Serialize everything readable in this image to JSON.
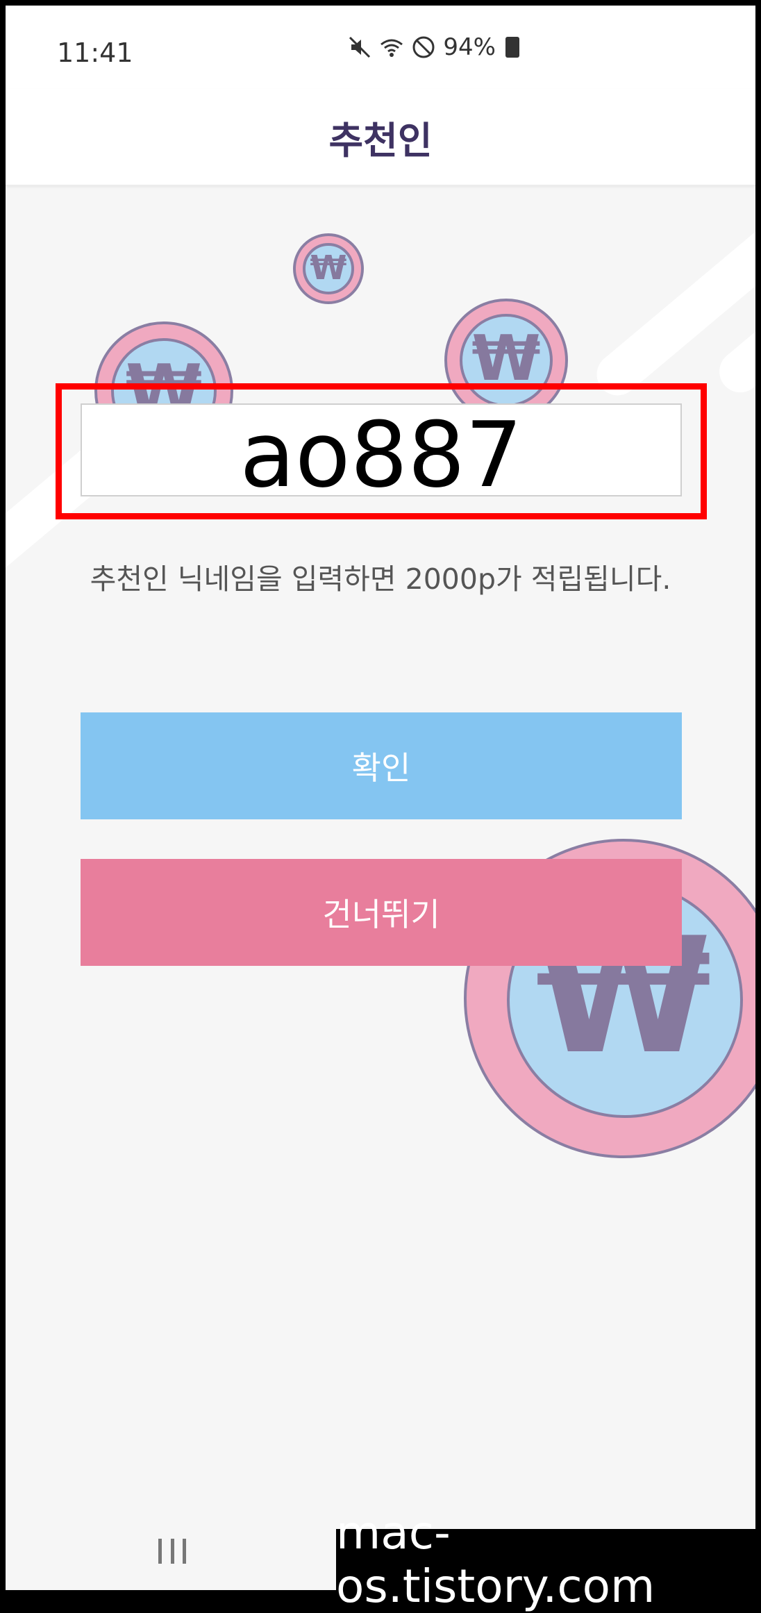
{
  "status_bar": {
    "time": "11:41",
    "battery": "94%"
  },
  "app_bar": {
    "title": "추천인"
  },
  "referral_input": {
    "value": "ao887"
  },
  "hint_text": "추천인 닉네임을 입력하면 2000p가 적립됩니다.",
  "buttons": {
    "confirm_label": "확인",
    "skip_label": "건너뛰기"
  },
  "coin_symbol": "₩",
  "watermark": "mac-os.tistory.com",
  "colors": {
    "confirm": "#84c5f1",
    "skip": "#e87e9c",
    "title": "#3e3262",
    "highlight": "#ff0000"
  }
}
